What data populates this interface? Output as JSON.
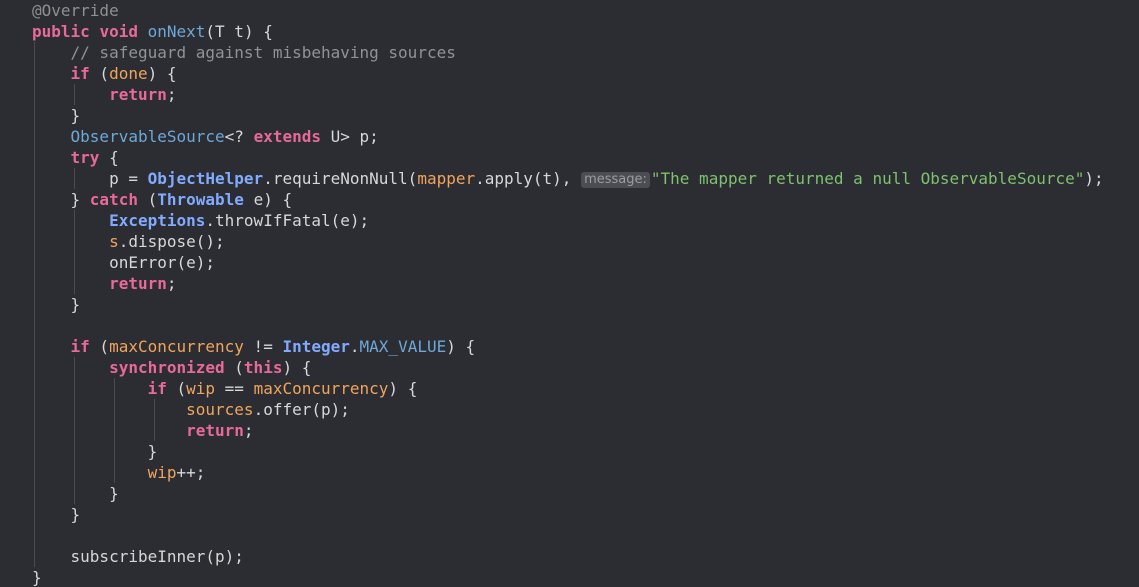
{
  "lines": [
    [
      {
        "t": "@Override",
        "c": "ann"
      }
    ],
    [
      {
        "t": "public",
        "c": "kw"
      },
      {
        "t": " "
      },
      {
        "t": "void",
        "c": "kw"
      },
      {
        "t": " "
      },
      {
        "t": "onNext",
        "c": "fn"
      },
      {
        "t": "(T t) {"
      }
    ],
    [
      {
        "t": "    "
      },
      {
        "t": "// safeguard against misbehaving sources",
        "c": "cmt"
      }
    ],
    [
      {
        "t": "    "
      },
      {
        "t": "if",
        "c": "kw"
      },
      {
        "t": " ("
      },
      {
        "t": "done",
        "c": "fld"
      },
      {
        "t": ") {"
      }
    ],
    [
      {
        "t": "        "
      },
      {
        "t": "return",
        "c": "kw"
      },
      {
        "t": ";"
      }
    ],
    [
      {
        "t": "    }"
      }
    ],
    [
      {
        "t": "    "
      },
      {
        "t": "ObservableSource",
        "c": "type"
      },
      {
        "t": "<? "
      },
      {
        "t": "extends",
        "c": "kw"
      },
      {
        "t": " U> p;"
      }
    ],
    [
      {
        "t": "    "
      },
      {
        "t": "try",
        "c": "kw"
      },
      {
        "t": " {"
      }
    ],
    [
      {
        "t": "        p = "
      },
      {
        "t": "ObjectHelper",
        "c": "typeb"
      },
      {
        "t": ".requireNonNull("
      },
      {
        "t": "mapper",
        "c": "fld"
      },
      {
        "t": ".apply(t), "
      },
      {
        "t": "message:",
        "c": "hint"
      },
      {
        "t": "\"The mapper returned a null ObservableSource\"",
        "c": "str"
      },
      {
        "t": ");"
      }
    ],
    [
      {
        "t": "    } "
      },
      {
        "t": "catch",
        "c": "kw"
      },
      {
        "t": " ("
      },
      {
        "t": "Throwable",
        "c": "typeb"
      },
      {
        "t": " e) {"
      }
    ],
    [
      {
        "t": "        "
      },
      {
        "t": "Exceptions",
        "c": "typeb"
      },
      {
        "t": ".throwIfFatal(e);"
      }
    ],
    [
      {
        "t": "        "
      },
      {
        "t": "s",
        "c": "fld"
      },
      {
        "t": ".dispose();"
      }
    ],
    [
      {
        "t": "        onError(e);"
      }
    ],
    [
      {
        "t": "        "
      },
      {
        "t": "return",
        "c": "kw"
      },
      {
        "t": ";"
      }
    ],
    [
      {
        "t": "    }"
      }
    ],
    [
      {
        "t": ""
      }
    ],
    [
      {
        "t": "    "
      },
      {
        "t": "if",
        "c": "kw"
      },
      {
        "t": " ("
      },
      {
        "t": "maxConcurrency",
        "c": "fld"
      },
      {
        "t": " != "
      },
      {
        "t": "Integer",
        "c": "typeb"
      },
      {
        "t": "."
      },
      {
        "t": "MAX_VALUE",
        "c": "type"
      },
      {
        "t": ") {"
      }
    ],
    [
      {
        "t": "        "
      },
      {
        "t": "synchronized",
        "c": "kw"
      },
      {
        "t": " ("
      },
      {
        "t": "this",
        "c": "kw"
      },
      {
        "t": ") {"
      }
    ],
    [
      {
        "t": "            "
      },
      {
        "t": "if",
        "c": "kw"
      },
      {
        "t": " ("
      },
      {
        "t": "wip",
        "c": "fld"
      },
      {
        "t": " == "
      },
      {
        "t": "maxConcurrency",
        "c": "fld"
      },
      {
        "t": ") {"
      }
    ],
    [
      {
        "t": "                "
      },
      {
        "t": "sources",
        "c": "fld"
      },
      {
        "t": ".offer(p);"
      }
    ],
    [
      {
        "t": "                "
      },
      {
        "t": "return",
        "c": "kw"
      },
      {
        "t": ";"
      }
    ],
    [
      {
        "t": "            }"
      }
    ],
    [
      {
        "t": "            "
      },
      {
        "t": "wip",
        "c": "fld"
      },
      {
        "t": "++;"
      }
    ],
    [
      {
        "t": "        }"
      }
    ],
    [
      {
        "t": "    }"
      }
    ],
    [
      {
        "t": ""
      }
    ],
    [
      {
        "t": "    subscribeInner(p);"
      }
    ],
    [
      {
        "t": "}"
      }
    ]
  ]
}
